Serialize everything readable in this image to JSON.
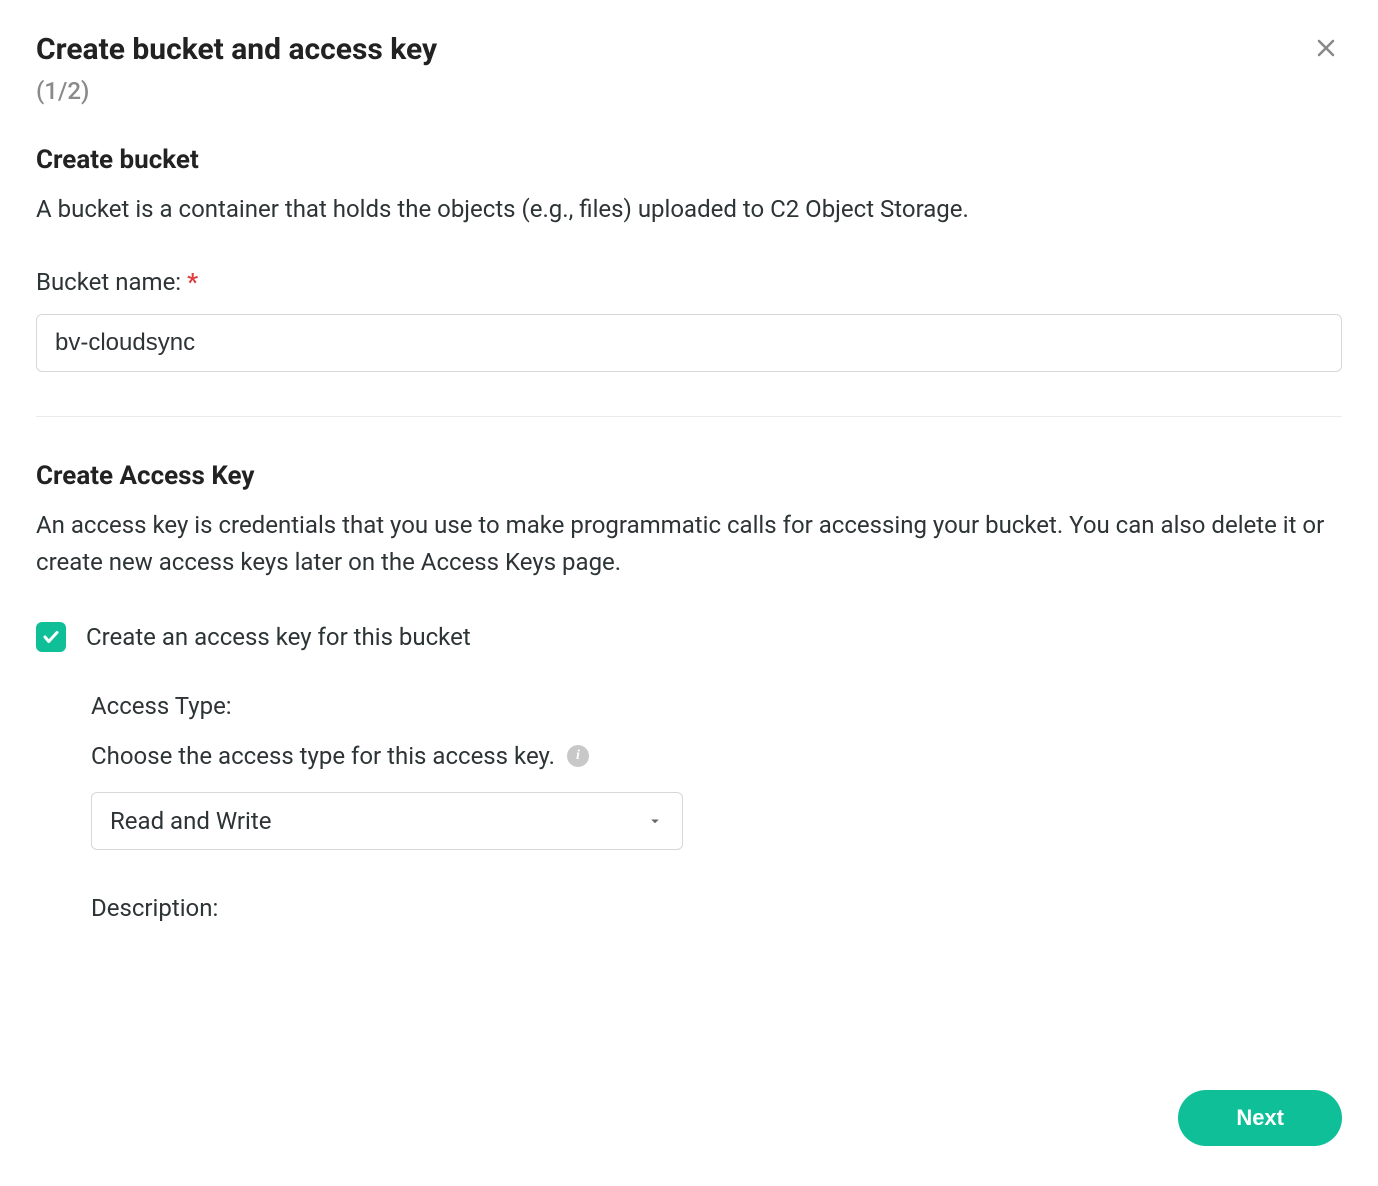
{
  "header": {
    "title": "Create bucket and access key",
    "step": "(1/2)"
  },
  "create_bucket": {
    "section_title": "Create bucket",
    "description": "A bucket is a container that holds the objects (e.g., files) uploaded to C2 Object Storage.",
    "name_label": "Bucket name:",
    "name_value": "bv-cloudsync"
  },
  "create_key": {
    "section_title": "Create Access Key",
    "description": "An access key is credentials that you use to make programmatic calls for accessing your bucket. You can also delete it or create new access keys later on the Access Keys page.",
    "checkbox_label": "Create an access key for this bucket",
    "checkbox_checked": true,
    "access_type": {
      "label": "Access Type:",
      "hint": "Choose the access type for this access key.",
      "selected": "Read and Write"
    },
    "description_label": "Description:"
  },
  "footer": {
    "next_label": "Next"
  }
}
